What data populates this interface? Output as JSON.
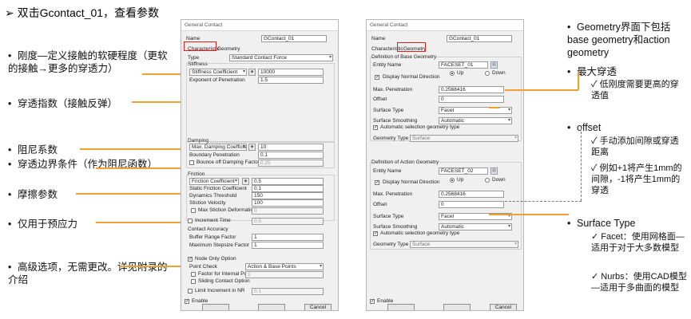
{
  "heading": {
    "bullet": "➢",
    "text": "双击Gcontact_01，查看参数"
  },
  "left_annotations": [
    {
      "bullet": "•",
      "text": "刚度—定义接触的软硬程度（更软的接触→更多的穿透力）"
    },
    {
      "bullet": "•",
      "text": "穿透指数（接触反弹）"
    },
    {
      "bullet": "•",
      "text": "阻尼系数"
    },
    {
      "bullet": "•",
      "text": "穿透边界条件（作为阻尼函数）"
    },
    {
      "bullet": "•",
      "text": "摩擦参数"
    },
    {
      "bullet": "•",
      "text": "仅用于预应力"
    },
    {
      "bullet": "•",
      "text": "高级选项，无需更改。详见附录的介绍"
    }
  ],
  "right_annotations": {
    "geometry": {
      "bullet": "•",
      "text": "Geometry界面下包括base geometry和action geometry"
    },
    "max_pen": {
      "bullet": "•",
      "text": "最大穿透"
    },
    "max_pen_sub": {
      "bullet": "✓",
      "text": "低刚度需要更高的穿透值"
    },
    "offset": {
      "bullet": "•",
      "text": "offset"
    },
    "offset_sub1": {
      "bullet": "✓",
      "text": "手动添加间隙或穿透距离"
    },
    "offset_sub2": {
      "bullet": "✓",
      "text": "例如+1将产生1mm的间隙，-1将产生1mm的穿透"
    },
    "surface": {
      "bullet": "•",
      "text": "Surface Type"
    },
    "surface_sub1": {
      "bullet": "✓",
      "text": "Facet：使用网格面—适用于对于大多数模型"
    },
    "surface_sub2": {
      "bullet": "✓",
      "text": "Nurbs：使用CAD模型—适用于多曲面的模型"
    }
  },
  "dialog1": {
    "title": "General Contact",
    "name_label": "Name",
    "name_value": "GContact_01",
    "tab_characteristic": "Characteristic",
    "tab_geometry": "Geometry",
    "type_label": "Type",
    "type_value": "Standard Contact Force",
    "stiffness_group": "Stiffness",
    "stiffness_select": "Stiffness Coefficient",
    "stiffness_value": "10000",
    "exponent_label": "Exponent of Penetration",
    "exponent_value": "1.5",
    "damping_group": "Damping",
    "damping_select": "Max. Damping Coefficient",
    "damping_value": "10",
    "boundary_label": "Boundary Penetration",
    "boundary_value": "0.1",
    "bounce_label": "Bounce off Damping Factor",
    "bounce_value": "0.25",
    "friction_group": "Friction",
    "friction_select": "Friction Coefficient",
    "friction_value": "0.5",
    "static_label": "Static Friction Coefficient",
    "static_value": "0.1",
    "dyn_label": "Dynamics Threshold",
    "dyn_value": "150",
    "stiction_label": "Stiction Velocity",
    "stiction_value": "100",
    "maxstiction_label": "Max Stiction Deformation",
    "maxstiction_value": "0",
    "increment_label": "Increment Time",
    "increment_value": "0.5",
    "accuracy_group": "Contact Accuracy",
    "buffer_label": "Buffer Range Factor",
    "buffer_value": "1",
    "stepsize_label": "Maximum Stepsize Factor",
    "stepsize_value": "1",
    "node_only_label": "Node Only Option",
    "point_check_label": "Point Check",
    "point_check_value": "Action & Base Points",
    "factor_label": "Factor for Internal Poin",
    "factor_value": "1",
    "sliding_label": "Sliding Contact Option",
    "limit_label": "Limit Increment in NR",
    "limit_value": "0.1",
    "enable_label": "Enable",
    "cancel_label": "Cancel"
  },
  "dialog2": {
    "title": "General Contact",
    "name_label": "Name",
    "name_value": "GContact_01",
    "tab_characteristic": "Characteristic",
    "tab_geometry": "Geometry",
    "base_group": "Definition of Base Geometry",
    "entity_label": "Entity Name",
    "base_entity_value": "FACESET_01",
    "display_normal_label": "Display Normal Direction",
    "up_label": "Up",
    "down_label": "Down",
    "max_pen_label": "Max. Penetration",
    "base_max_pen_value": "0.2568416",
    "offset_label": "Offset",
    "base_offset_value": "0",
    "surface_type_label": "Surface Type",
    "base_surface_type": "Facet",
    "surface_smoothing_label": "Surface Smoothing",
    "base_smoothing": "Automatic",
    "auto_sel_label": "Automatic selection geometry type",
    "geometry_type_label": "Geometry Type",
    "base_geometry_type": "Surface",
    "action_group": "Definition of Action Geometry",
    "action_entity_value": "FACESET_02",
    "action_max_pen_value": "0.2568416",
    "action_offset_value": "0",
    "action_surface_type": "Facet",
    "action_smoothing": "Automatic",
    "action_geometry_type": "Surface",
    "enable_label": "Enable",
    "cancel_label": "Cancel"
  },
  "colors": {
    "red_highlight": "#e02020",
    "orange_highlight": "#f0a030"
  }
}
